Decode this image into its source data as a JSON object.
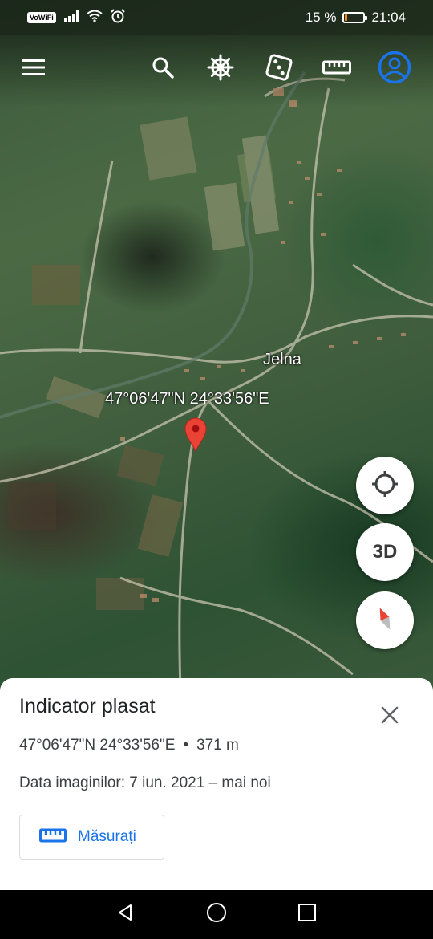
{
  "status_bar": {
    "network_badge": "VoWiFi",
    "battery_text": "15 %",
    "battery_level": 0.15,
    "time": "21:04",
    "battery_color": "#ff8c1a"
  },
  "toolbar": {
    "icons": [
      "menu-icon",
      "search-icon",
      "voyager-wheel-icon",
      "dice-icon",
      "ruler-icon",
      "account-icon"
    ],
    "accent_color": "#1a73e8"
  },
  "map": {
    "place_label": "Jelna",
    "coordinate_label": "47°06'47\"N 24°33'56\"E",
    "pin_color": "#ea4335"
  },
  "fab": {
    "locate_icon": "crosshair-icon",
    "view_3d_label": "3D",
    "compass_icon": "compass-icon"
  },
  "sheet": {
    "title": "Indicator plasat",
    "coordinates": "47°06'47\"N 24°33'56\"E",
    "separator": "•",
    "elevation": "371 m",
    "imagery_date": "Data imaginilor: 7 iun. 2021 – mai noi",
    "measure_label": "Măsurați"
  },
  "nav_bar": {
    "icons": [
      "back-icon",
      "home-icon",
      "recents-icon"
    ]
  }
}
